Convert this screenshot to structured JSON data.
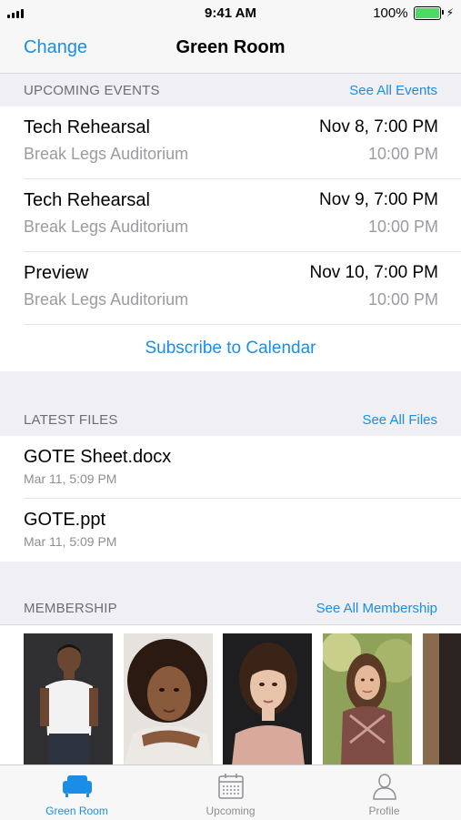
{
  "status_bar": {
    "time": "9:41 AM",
    "battery": "100%"
  },
  "nav": {
    "left_button": "Change",
    "title": "Green Room"
  },
  "upcoming": {
    "header": "UPCOMING EVENTS",
    "link": "See All Events",
    "events": [
      {
        "name": "Tech Rehearsal",
        "start": "Nov 8, 7:00 PM",
        "location": "Break Legs Auditorium",
        "end": "10:00 PM"
      },
      {
        "name": "Tech Rehearsal",
        "start": "Nov 9, 7:00 PM",
        "location": "Break Legs Auditorium",
        "end": "10:00 PM"
      },
      {
        "name": "Preview",
        "start": "Nov 10, 7:00 PM",
        "location": "Break Legs Auditorium",
        "end": "10:00 PM"
      }
    ],
    "subscribe": "Subscribe to Calendar"
  },
  "files": {
    "header": "LATEST FILES",
    "link": "See All Files",
    "items": [
      {
        "name": "GOTE Sheet.docx",
        "date": "Mar 11, 5:09 PM"
      },
      {
        "name": "GOTE.ppt",
        "date": "Mar 11, 5:09 PM"
      }
    ]
  },
  "membership": {
    "header": "MEMBERSHIP",
    "link": "See All Membership"
  },
  "tabs": [
    {
      "label": "Green Room",
      "icon": "sofa-icon",
      "active": true
    },
    {
      "label": "Upcoming",
      "icon": "calendar-icon",
      "active": false
    },
    {
      "label": "Profile",
      "icon": "person-icon",
      "active": false
    }
  ],
  "colors": {
    "accent": "#1a8ee6",
    "background": "#efeff4",
    "battery": "#4cd964"
  }
}
